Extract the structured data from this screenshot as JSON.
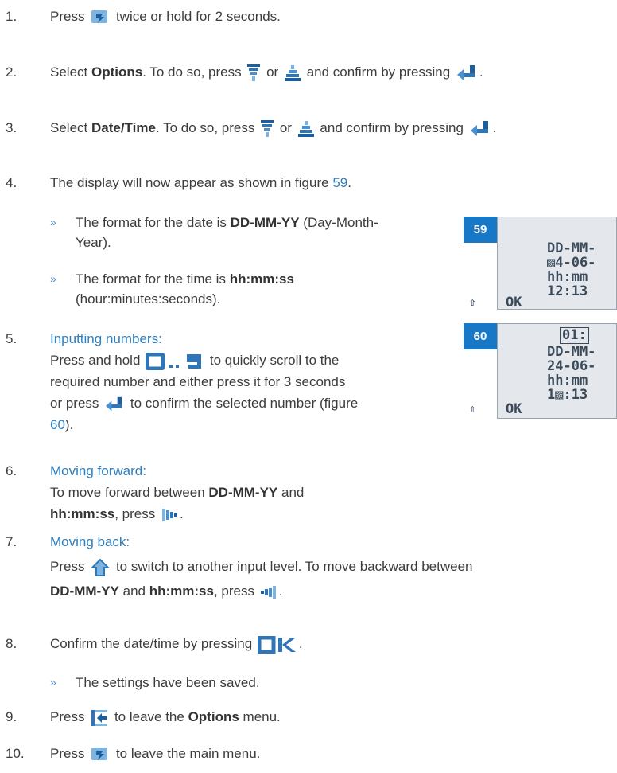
{
  "steps": [
    {
      "num": "1.",
      "pre": "Press",
      "post": "twice or hold for 2 seconds."
    },
    {
      "num": "2.",
      "pre": "Select",
      "bold": "Options",
      "mid": ". To do so, press",
      "or": "or",
      "post": "and confirm by pressing",
      "end": "."
    },
    {
      "num": "3.",
      "pre": "Select",
      "bold": "Date/Time",
      "mid": ". To do so, press",
      "or": "or",
      "post": "and confirm by pressing",
      "end": "."
    },
    {
      "num": "4.",
      "pre": "The display will now appear as shown in figure",
      "link": "59",
      "end": "."
    },
    {
      "num": "5.",
      "heading": "Inputting numbers:",
      "l1a": "Press and hold",
      "l1b": "to quickly scroll to the",
      "l2": "required number and either press it for 3 seconds",
      "l3a": "or press",
      "l3b": "to confirm the selected number (figure",
      "l4link": "60",
      "l4end": ")."
    },
    {
      "num": "6.",
      "heading": "Moving forward:",
      "l1a": "To move forward between",
      "l1bold": "DD-MM-YY",
      "l1b": "and",
      "l2bold": "hh:mm:ss",
      "l2a": ", press",
      "l2end": "."
    },
    {
      "num": "7.",
      "heading": "Moving back:",
      "l1a": "Press",
      "l1b": "to switch to another input level. To move backward between",
      "l2bold1": "DD-MM-YY",
      "l2a": "and",
      "l2bold2": "hh:mm:ss",
      "l2b": ", press",
      "l2end": "."
    },
    {
      "num": "8.",
      "pre": "Confirm the date/time by pressing",
      "end": "."
    },
    {
      "num": "9.",
      "pre": "Press",
      "post": "to leave the",
      "bold": "Options",
      "end": "menu."
    },
    {
      "num": "10.",
      "pre": "Press",
      "post": "to leave the main menu."
    }
  ],
  "bullets": {
    "date_a": "The format for the date is",
    "date_bold": "DD-MM-YY",
    "date_b": "(Day-Month-",
    "date_c": "Year).",
    "time_a": "The format for the time is",
    "time_bold": "hh:mm:ss",
    "time_c": "(hour:minutes:seconds).",
    "saved": "The settings have been saved."
  },
  "bullet_glyph": "»",
  "figures": [
    {
      "number": "59",
      "lines": [
        "DD-MM-",
        "▨4-06-",
        "hh:mm",
        "12:13"
      ],
      "ok": "OK",
      "arrow": "⇧"
    },
    {
      "number": "60",
      "top": "01:",
      "lines": [
        "DD-MM-",
        "24-06-",
        "hh:mm",
        "1▨:13"
      ],
      "ok": "OK",
      "arrow": "⇧"
    }
  ],
  "colors": {
    "text": "#3c3c3c",
    "link": "#2d7fc0",
    "figure_tag": "#1878c8",
    "lcd": "#e4e8ec"
  },
  "icons": [
    "menu-key-icon",
    "down-arrow-key-icon",
    "up-arrow-key-icon",
    "enter-key-icon",
    "digit-keys-icon",
    "right-arrow-key-icon",
    "level-up-key-icon",
    "left-arrow-key-icon",
    "ok-key-icon",
    "exit-menu-key-icon"
  ]
}
